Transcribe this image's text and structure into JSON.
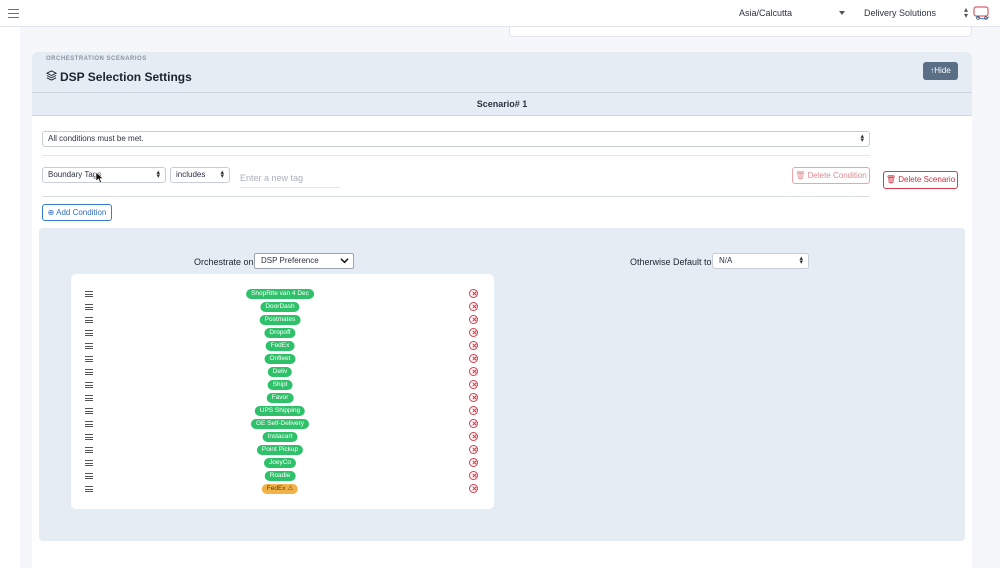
{
  "topbar": {
    "timezone": "Asia/Calcutta",
    "organization": "Delivery Solutions"
  },
  "card": {
    "eyebrow": "ORCHESTRATION SCENARIOS",
    "title": "DSP Selection Settings",
    "hide_label": "↑Hide",
    "scenario_label": "Scenario# 1"
  },
  "conditions": {
    "match_mode": "All conditions must be met.",
    "tag_field": "Boundary Tags",
    "operator": "includes",
    "tag_placeholder": "Enter a new tag",
    "delete_condition_label": "Delete Condition",
    "delete_scenario_label": "Delete Scenario",
    "add_condition_label": "Add Condition"
  },
  "orchestration": {
    "orchestrate_label": "Orchestrate on",
    "orchestrate_value": "DSP Preference",
    "default_label": "Otherwise Default to",
    "default_value": "N/A"
  },
  "dsp_list": [
    {
      "name": "ShopRite van 4 Dec",
      "status": "ok"
    },
    {
      "name": "DoorDash",
      "status": "ok"
    },
    {
      "name": "Postmates",
      "status": "ok"
    },
    {
      "name": "Dropoff",
      "status": "ok"
    },
    {
      "name": "FedEx",
      "status": "ok"
    },
    {
      "name": "Onfleet",
      "status": "ok"
    },
    {
      "name": "Deliv",
      "status": "ok"
    },
    {
      "name": "Shipt",
      "status": "ok"
    },
    {
      "name": "Favor",
      "status": "ok"
    },
    {
      "name": "UPS Shipping",
      "status": "ok"
    },
    {
      "name": "GE Self-Delivery",
      "status": "ok"
    },
    {
      "name": "Instacart",
      "status": "ok"
    },
    {
      "name": "Point Pickup",
      "status": "ok"
    },
    {
      "name": "JoeyCo",
      "status": "ok"
    },
    {
      "name": "Roadie",
      "status": "ok"
    },
    {
      "name": "FedEx ⚠",
      "status": "warning"
    }
  ],
  "colors": {
    "pill_ok": "#2ec16a",
    "pill_warning": "#f2b24a",
    "danger": "#d43c4a",
    "primary": "#3a7bd5"
  }
}
